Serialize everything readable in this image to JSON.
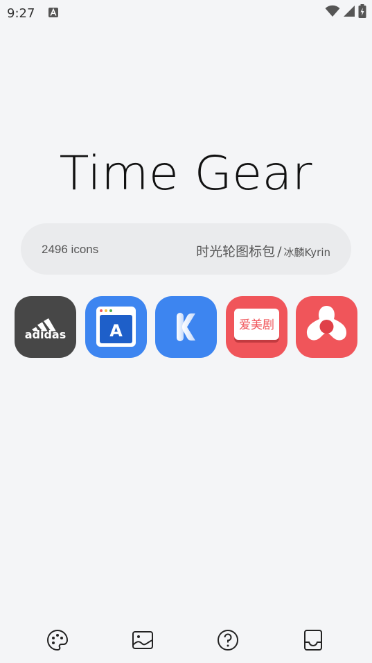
{
  "status_bar": {
    "time": "9:27",
    "notification_icon": "a-letter-icon",
    "right_icons": [
      "wifi-icon",
      "signal-icon",
      "battery-charging-icon"
    ]
  },
  "header": {
    "title": "Time Gear"
  },
  "info": {
    "icon_count": "2496 icons",
    "pack_name": "时光轮图标包",
    "separator": "/",
    "author": "冰麟Kyrin"
  },
  "icons": [
    {
      "name": "adidas",
      "label": "adidas",
      "bg": "#474747",
      "icon": "adidas-icon"
    },
    {
      "name": "a-app",
      "label": "A",
      "bg": "#3d85f0",
      "icon": "a-letter-window-icon"
    },
    {
      "name": "kwgt",
      "label": "K",
      "bg": "#3d85f0",
      "icon": "k-letter-icon"
    },
    {
      "name": "aimeiju",
      "label": "爱美剧",
      "bg": "#f0555a",
      "icon": "aimeiju-icon"
    },
    {
      "name": "adobe-air",
      "label": "",
      "bg": "#f0555a",
      "icon": "adobe-air-icon"
    }
  ],
  "nav": [
    {
      "name": "theme",
      "icon": "palette-icon"
    },
    {
      "name": "wallpaper",
      "icon": "image-icon"
    },
    {
      "name": "help",
      "icon": "question-icon"
    },
    {
      "name": "request",
      "icon": "inbox-icon"
    }
  ],
  "colors": {
    "background": "#f4f5f7",
    "pill": "#eaebed",
    "blue": "#3d85f0",
    "red": "#f0555a",
    "dark": "#474747"
  }
}
